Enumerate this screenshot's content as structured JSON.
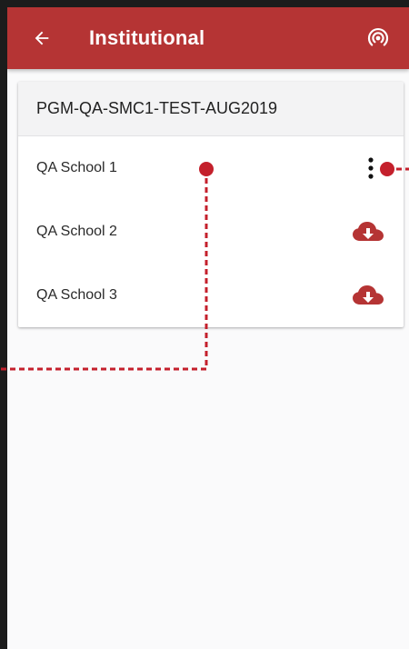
{
  "appbar": {
    "title": "Institutional",
    "back_icon": "arrow-left-icon",
    "sync_icon": "broadcast-icon",
    "color": "#b53434"
  },
  "card": {
    "title": "PGM-QA-SMC1-TEST-AUG2019",
    "schools": [
      {
        "label": "QA School 1",
        "action_icon": "more-vertical-icon"
      },
      {
        "label": "QA School 2",
        "action_icon": "cloud-download-icon"
      },
      {
        "label": "QA School 3",
        "action_icon": "cloud-download-icon"
      }
    ]
  },
  "annotations": {
    "marker_color": "#c4202c",
    "style": "dashed-callout"
  }
}
